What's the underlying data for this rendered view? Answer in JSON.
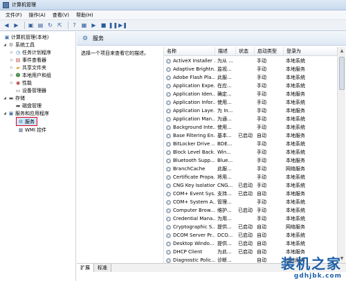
{
  "window": {
    "title": "计算机管理"
  },
  "menu": [
    "文件(F)",
    "操作(A)",
    "查看(V)",
    "帮助(H)"
  ],
  "toolbar": [
    "back-icon",
    "forward-icon",
    "up-icon",
    "show-tree-icon",
    "refresh-icon",
    "export-icon",
    "help-icon",
    "properties-icon",
    "play-icon",
    "stop-icon",
    "pause-icon",
    "restart-icon"
  ],
  "tree": [
    {
      "label": "计算机管理(本地)",
      "depth": 0,
      "icon": "computer-icon"
    },
    {
      "label": "系统工具",
      "depth": 1,
      "icon": "tools-icon",
      "expand": "◢"
    },
    {
      "label": "任务计划程序",
      "depth": 2,
      "icon": "clock-icon",
      "expand": "▷"
    },
    {
      "label": "事件查看器",
      "depth": 2,
      "icon": "event-icon",
      "expand": "▷"
    },
    {
      "label": "共享文件夹",
      "depth": 2,
      "icon": "folder-icon",
      "expand": "▷"
    },
    {
      "label": "本地用户和组",
      "depth": 2,
      "icon": "users-icon",
      "expand": "▷"
    },
    {
      "label": "性能",
      "depth": 2,
      "icon": "performance-icon",
      "expand": "▷"
    },
    {
      "label": "设备管理器",
      "depth": 2,
      "icon": "device-icon"
    },
    {
      "label": "存储",
      "depth": 1,
      "icon": "storage-icon",
      "expand": "◢"
    },
    {
      "label": "磁盘管理",
      "depth": 2,
      "icon": "disk-icon"
    },
    {
      "label": "服务和应用程序",
      "depth": 1,
      "icon": "apps-icon",
      "expand": "◢"
    },
    {
      "label": "服务",
      "depth": 2,
      "icon": "services-icon",
      "selected": true
    },
    {
      "label": "WMI 控件",
      "depth": 2,
      "icon": "wmi-icon"
    }
  ],
  "panel": {
    "title": "服务",
    "description": "选择一个项目来查看它的描述。"
  },
  "columns": [
    "名称",
    "描述",
    "状态",
    "启动类型",
    "登录为"
  ],
  "services": [
    [
      "ActiveX Installer ...",
      "为从 ...",
      "",
      "手动",
      "本地系统"
    ],
    [
      "Adaptive Brightn...",
      "监视...",
      "",
      "手动",
      "本地服务"
    ],
    [
      "Adobe Flash Pla...",
      "此服...",
      "",
      "手动",
      "本地系统"
    ],
    [
      "Application Expe...",
      "在应...",
      "",
      "手动",
      "本地系统"
    ],
    [
      "Application Iden...",
      "确定...",
      "",
      "手动",
      "本地服务"
    ],
    [
      "Application Infor...",
      "使用...",
      "",
      "手动",
      "本地系统"
    ],
    [
      "Application Laye...",
      "为 In...",
      "",
      "手动",
      "本地服务"
    ],
    [
      "Application Man...",
      "为通...",
      "",
      "手动",
      "本地系统"
    ],
    [
      "Background Inte...",
      "使用...",
      "",
      "手动",
      "本地系统"
    ],
    [
      "Base Filtering En...",
      "基本...",
      "已启动",
      "自动",
      "本地服务"
    ],
    [
      "BitLocker Drive ...",
      "BDE...",
      "",
      "手动",
      "本地系统"
    ],
    [
      "Block Level Back...",
      "Win...",
      "",
      "手动",
      "本地系统"
    ],
    [
      "Bluetooth Supp...",
      "Blue...",
      "",
      "手动",
      "本地服务"
    ],
    [
      "BranchCache",
      "此服...",
      "",
      "手动",
      "网络服务"
    ],
    [
      "Certificate Propa...",
      "将用...",
      "",
      "手动",
      "本地系统"
    ],
    [
      "CNG Key Isolation",
      "CNG...",
      "已启动",
      "手动",
      "本地系统"
    ],
    [
      "COM+ Event Sys...",
      "支持...",
      "已启动",
      "自动",
      "本地服务"
    ],
    [
      "COM+ System A...",
      "管理...",
      "",
      "手动",
      "本地系统"
    ],
    [
      "Computer Brow...",
      "维护...",
      "已启动",
      "手动",
      "本地系统"
    ],
    [
      "Credential Mana...",
      "为用...",
      "",
      "手动",
      "本地系统"
    ],
    [
      "Cryptographic S...",
      "提供...",
      "已启动",
      "自动",
      "网络服务"
    ],
    [
      "DCOM Server Pr...",
      "DCO...",
      "已启动",
      "自动",
      "本地系统"
    ],
    [
      "Desktop Windo...",
      "提供...",
      "已启动",
      "自动",
      "本地系统"
    ],
    [
      "DHCP Client",
      "为此...",
      "已启动",
      "自动",
      "本地服务"
    ],
    [
      "Diagnostic Polic...",
      "诊断...",
      "",
      "自动",
      "本地服务"
    ]
  ],
  "tabs": [
    "扩展",
    "标准"
  ],
  "watermark": {
    "line1": "装机之家",
    "line2": "gdhjbk.com"
  }
}
